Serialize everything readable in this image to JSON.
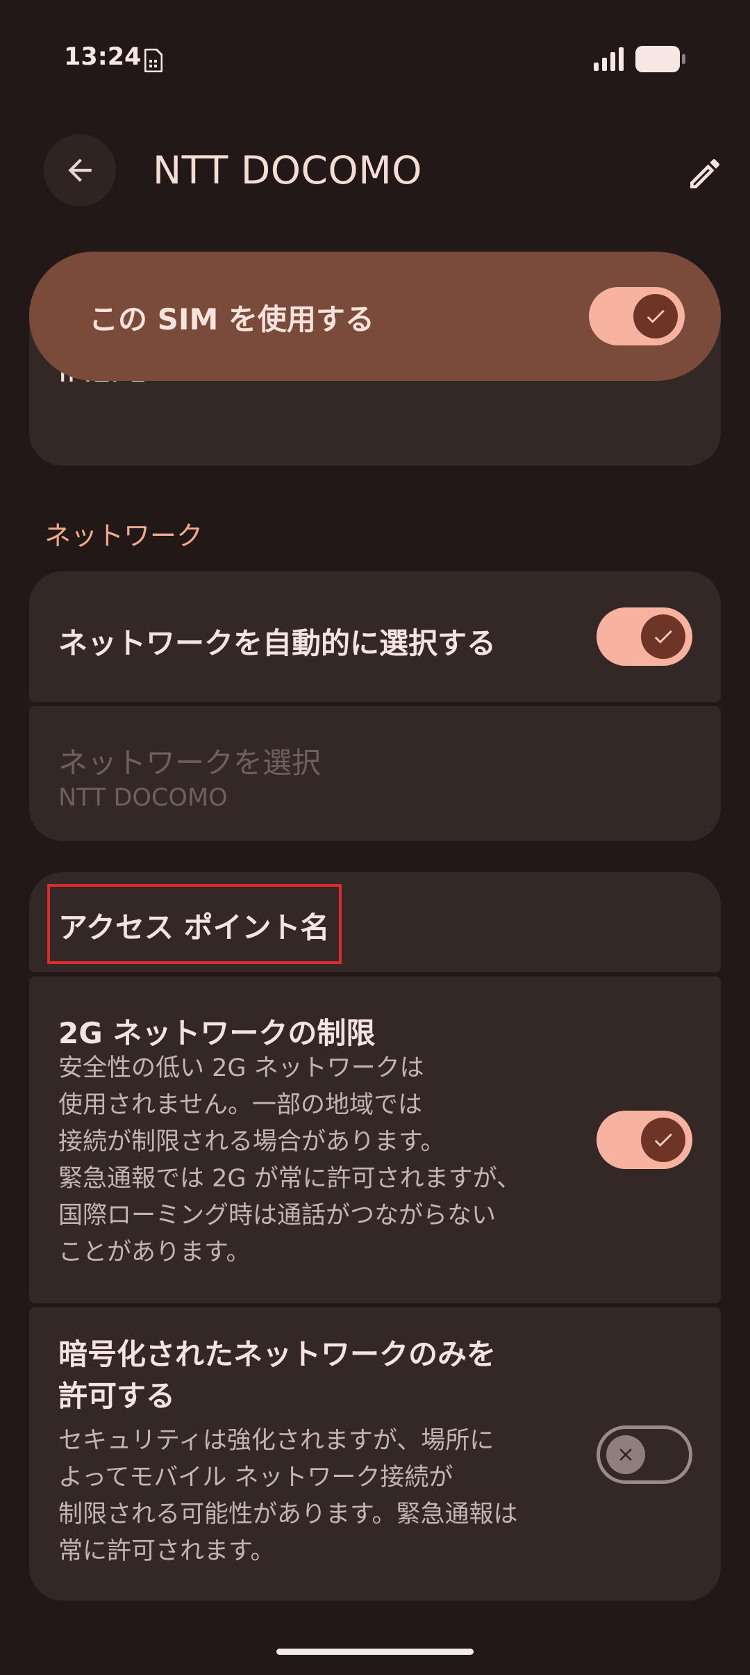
{
  "status_bar": {
    "time": "13:24"
  },
  "header": {
    "title": "NTT DOCOMO"
  },
  "sim": {
    "toggle_label": "この SIM を使用する",
    "toggle_on": true,
    "imei_label": "IMEI 1"
  },
  "network": {
    "section_title": "ネットワーク",
    "auto_select_label": "ネットワークを自動的に選択する",
    "auto_select_on": true,
    "select_title": "ネットワークを選択",
    "select_value": "NTT DOCOMO"
  },
  "apn": {
    "label": "アクセス ポイント名"
  },
  "restrict_2g": {
    "title": "2G ネットワークの制限",
    "description": "安全性の低い 2G ネットワークは\n使用されません。一部の地域では\n接続が制限される場合があります。\n緊急通報では 2G が常に許可されますが、\n国際ローミング時は通話がつながらない\nことがあります。",
    "on": true
  },
  "encrypted_only": {
    "title": "暗号化されたネットワークのみを\n許可する",
    "description": "セキュリティは強化されますが、場所に\nよってモバイル ネットワーク接続が\n制限される可能性があります。緊急通報は\n常に許可されます。",
    "on": false
  },
  "colors": {
    "background": "#221817",
    "card": "#332826",
    "accent": "#f7b39f",
    "highlight": "#d92d2d"
  }
}
